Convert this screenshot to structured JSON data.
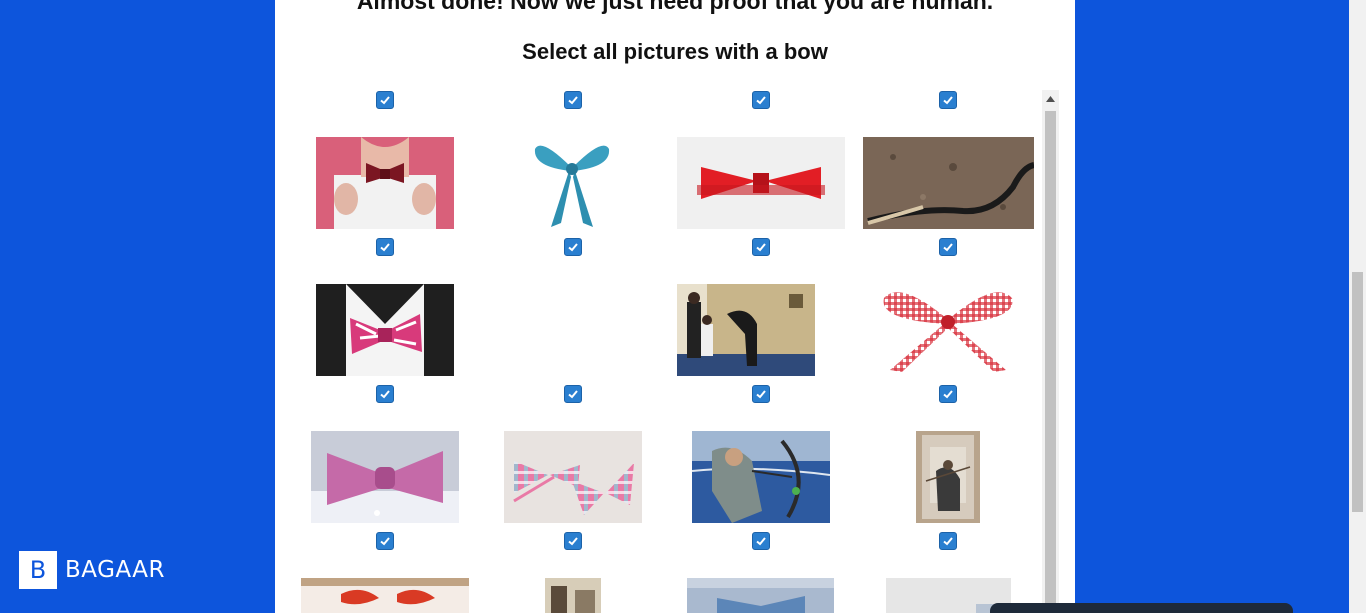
{
  "page": {
    "title": "Almost done! Now we just need proof that you are human.",
    "subtitle": "Select all pictures with a bow"
  },
  "brand": {
    "mark": "B",
    "name": "BAGAAR"
  },
  "colors": {
    "background": "#0d55dc",
    "checkbox": "#2a7fd0"
  },
  "captcha": {
    "rows": [
      {
        "items": [
          {
            "label": "header-checkbox-1",
            "checked": true
          },
          {
            "label": "header-checkbox-2",
            "checked": true
          },
          {
            "label": "header-checkbox-3",
            "checked": true
          },
          {
            "label": "header-checkbox-4",
            "checked": true
          }
        ]
      },
      {
        "items": [
          {
            "picture": "man-with-red-bowtie",
            "checked": true
          },
          {
            "picture": "blue-ribbon-bow",
            "checked": true
          },
          {
            "picture": "red-bowtie",
            "checked": true
          },
          {
            "picture": "snake-on-ground",
            "checked": true
          }
        ]
      },
      {
        "items": [
          {
            "picture": "pink-striped-bowtie",
            "checked": true
          },
          {
            "picture": "blank",
            "checked": true
          },
          {
            "picture": "man-bowing-in-office",
            "checked": true
          },
          {
            "picture": "gingham-ribbon-bow",
            "checked": true
          }
        ]
      },
      {
        "items": [
          {
            "picture": "pink-bowtie-teddy",
            "checked": true
          },
          {
            "picture": "plaid-bowtie-pair",
            "checked": true
          },
          {
            "picture": "archer-with-compound-bow",
            "checked": true
          },
          {
            "picture": "violinist-with-bow",
            "checked": true
          }
        ]
      }
    ]
  }
}
